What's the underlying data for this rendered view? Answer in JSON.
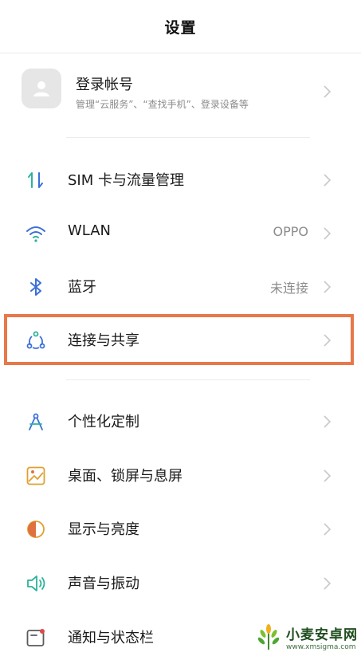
{
  "header": {
    "title": "设置"
  },
  "account": {
    "name": "登录帐号",
    "desc": "管理“云服务”、“查找手机”、登录设备等"
  },
  "items": [
    {
      "label": "SIM 卡与流量管理",
      "value": "",
      "icon": "sim-icon"
    },
    {
      "label": "WLAN",
      "value": "OPPO",
      "icon": "wifi-icon"
    },
    {
      "label": "蓝牙",
      "value": "未连接",
      "icon": "bluetooth-icon"
    },
    {
      "label": "连接与共享",
      "value": "",
      "icon": "connection-share-icon"
    },
    {
      "label": "个性化定制",
      "value": "",
      "icon": "personalize-icon"
    },
    {
      "label": "桌面、锁屏与息屏",
      "value": "",
      "icon": "wallpaper-icon"
    },
    {
      "label": "显示与亮度",
      "value": "",
      "icon": "brightness-icon"
    },
    {
      "label": "声音与振动",
      "value": "",
      "icon": "sound-icon"
    },
    {
      "label": "通知与状态栏",
      "value": "",
      "icon": "notification-icon"
    }
  ],
  "watermark": {
    "main": "小麦安卓网",
    "sub": "www.xmsigma.com"
  },
  "colors": {
    "accent_highlight": "#e8784a",
    "icon_green": "#2bb39a",
    "icon_blue": "#3a6fd8"
  }
}
